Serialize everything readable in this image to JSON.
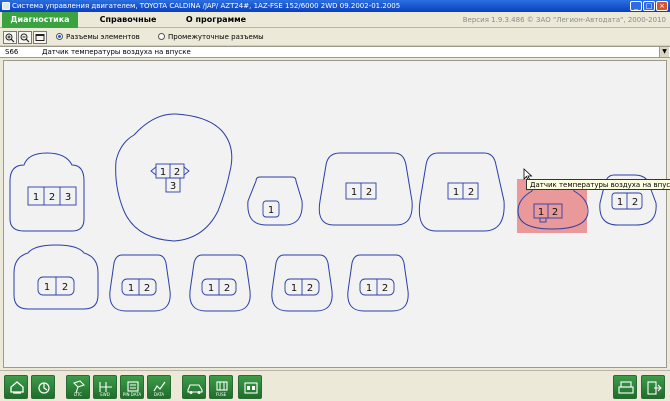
{
  "window": {
    "title": "Система управления двигателем, TOYOTA  CALDINA /JAP/  AZT24#,   1AZ-FSE  152/6000  2WD  09.2002-01.2005",
    "minimize": "_",
    "maximize": "□",
    "close": "×"
  },
  "menu": {
    "items": [
      {
        "label": "Диагностика"
      },
      {
        "label": "Справочные данные"
      },
      {
        "label": "О программе"
      }
    ],
    "version": "Версия 1.9.3.486 © ЗАО \"Легион-Автодата\", 2000-2010"
  },
  "toolbar": {
    "radio_elements": "Разъемы элементов",
    "radio_intermediate": "Промежуточные разъемы"
  },
  "info": {
    "code": "S66",
    "description": "Датчик температуры воздуха на впуске"
  },
  "tooltip": "Датчик температуры воздуха на впуске",
  "pins": {
    "p1": "1",
    "p2": "2",
    "p3": "3"
  },
  "colors": {
    "outline": "#2a3fa8",
    "highlight": "#e88a8a",
    "active_menu": "#3aa23e"
  },
  "bottom_buttons": [
    {
      "icon": "home-icon",
      "label": ""
    },
    {
      "icon": "scan-icon",
      "label": ""
    },
    {
      "icon": "dtc-icon",
      "label": "DTC"
    },
    {
      "icon": "ewd-icon",
      "label": "EWD"
    },
    {
      "icon": "pin-data-icon",
      "label": "PIN DATA"
    },
    {
      "icon": "data-icon",
      "label": "DATA"
    },
    {
      "icon": "vehicle-icon",
      "label": ""
    },
    {
      "icon": "fuse-icon",
      "label": "FUSE"
    },
    {
      "icon": "connector-icon",
      "label": ""
    },
    {
      "icon": "print-icon",
      "label": ""
    },
    {
      "icon": "exit-icon",
      "label": ""
    }
  ]
}
